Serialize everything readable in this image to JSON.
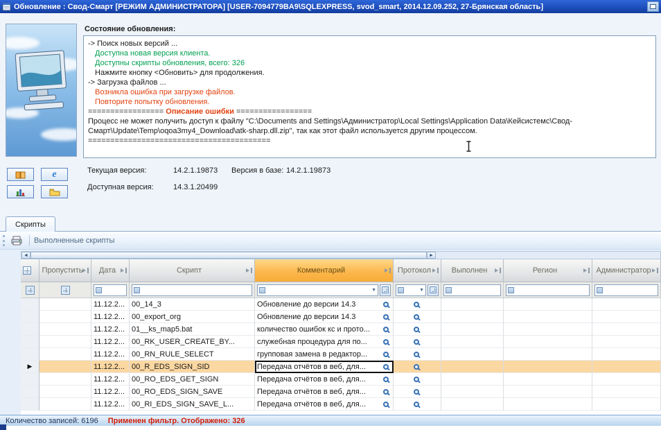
{
  "window": {
    "title": "Обновление : Свод-Смарт [РЕЖИМ АДМИНИСТРАТОРА] [USER-7094779BA9\\SQLEXPRESS, svod_smart, 2014.12.09.252, 27-Брянская область]"
  },
  "icons": {
    "row_marker": "▶",
    "dropdown_arrow": "▼",
    "scroll_left": "◄",
    "scroll_right": "►"
  },
  "status_panel": {
    "heading": "Состояние обновления:",
    "lines": [
      {
        "text": "-> Поиск новых версий ...",
        "color": "black",
        "indent": false
      },
      {
        "text": "Доступна новая версия клиента.",
        "color": "green",
        "indent": true
      },
      {
        "text": "Доступны скрипты обновления, всего: 326",
        "color": "green",
        "indent": true
      },
      {
        "text": "Нажмите кнопку <Обновить> для продолжения.",
        "color": "black",
        "indent": true
      },
      {
        "text": "-> Загрузка файлов ...",
        "color": "black",
        "indent": false
      },
      {
        "text": "Возникла ошибка при загрузке файлов.",
        "color": "red",
        "indent": true
      },
      {
        "text": "Повторите попытку обновления.",
        "color": "red",
        "indent": true
      }
    ],
    "error_header_prefix": "================= ",
    "error_header_title": "Описание ошибки",
    "error_header_suffix": " =================",
    "error_text": "Процесс не может получить доступ к файлу \"C:\\Documents and Settings\\Администратор\\Local Settings\\Application Data\\Кейсистемс\\Свод-Смарт\\Update\\Temp\\oqoa3my4_Download\\atk-sharp.dll.zip\", так как этот файл используется другим процессом.",
    "error_footer": "========================================="
  },
  "versions": {
    "current_label": "Текущая версия:",
    "current_value": "14.2.1.19873",
    "db_label": "Версия в базе:",
    "db_value": "14.2.1.19873",
    "available_label": "Доступная версия:",
    "available_value": "14.3.1.20499"
  },
  "tabs": {
    "scripts": "Скрипты"
  },
  "toolbar": {
    "executed_scripts": "Выполненные скрипты"
  },
  "grid": {
    "columns": [
      "",
      "Пропустить",
      "Дата",
      "Скрипт",
      "Комментарий",
      "Протокол",
      "Выполнен",
      "Регион",
      "Администратор"
    ],
    "rows": [
      {
        "date": "11.12.2...",
        "script": "00_14_3",
        "comment": "Обновление до версии 14.3",
        "selected": false
      },
      {
        "date": "11.12.2...",
        "script": "00_export_org",
        "comment": "Обновление до версии 14.3",
        "selected": false
      },
      {
        "date": "11.12.2...",
        "script": "01__ks_map5.bat",
        "comment": "количество ошибок кс и прото...",
        "selected": false
      },
      {
        "date": "11.12.2...",
        "script": "00_RK_USER_CREATE_BY...",
        "comment": "служебная процедура для по...",
        "selected": false
      },
      {
        "date": "11.12.2...",
        "script": "00_RN_RULE_SELECT",
        "comment": "групповая замена в редактор...",
        "selected": false
      },
      {
        "date": "11.12.2...",
        "script": "00_R_EDS_SIGN_SID",
        "comment": "Передача отчётов в веб, для...",
        "selected": true
      },
      {
        "date": "11.12.2...",
        "script": "00_RO_EDS_GET_SIGN",
        "comment": "Передача отчётов в веб, для...",
        "selected": false
      },
      {
        "date": "11.12.2...",
        "script": "00_RO_EDS_SIGN_SAVE",
        "comment": "Передача отчётов в веб, для...",
        "selected": false
      },
      {
        "date": "11.12.2...",
        "script": "00_RI_EDS_SIGN_SAVE_L...",
        "comment": "Передача отчётов в веб, для...",
        "selected": false
      }
    ]
  },
  "statusbar": {
    "records": "Количество записей: 6196",
    "filter": "Применен фильтр. Отображено: 326"
  }
}
